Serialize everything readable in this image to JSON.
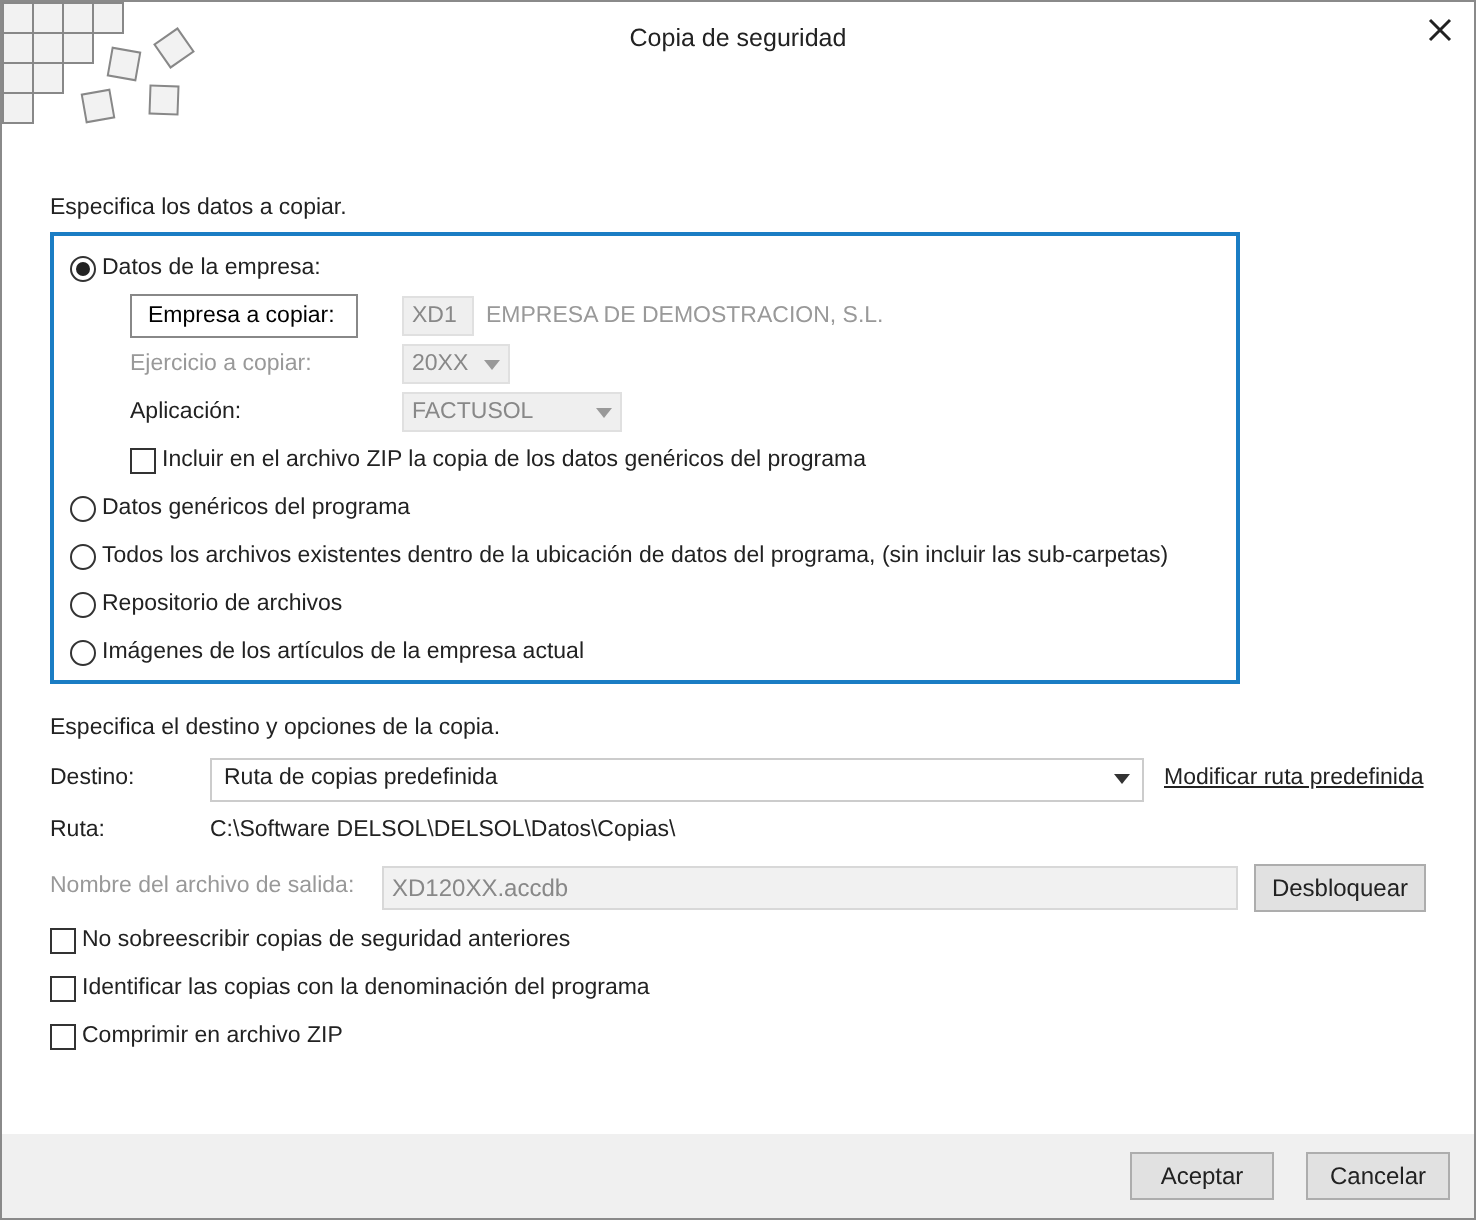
{
  "window": {
    "title": "Copia de seguridad"
  },
  "source": {
    "heading": "Especifica los datos a copiar.",
    "options": [
      {
        "label": "Datos de la empresa:",
        "selected": true
      },
      {
        "label": "Datos genéricos del programa",
        "selected": false
      },
      {
        "label": "Todos los archivos existentes dentro de la ubicación de datos del programa, (sin incluir las sub-carpetas)",
        "selected": false
      },
      {
        "label": "Repositorio de archivos",
        "selected": false
      },
      {
        "label": "Imágenes de los artículos de la empresa actual",
        "selected": false
      }
    ],
    "company": {
      "button": "Empresa a copiar:",
      "code": "XD1",
      "name": "EMPRESA DE DEMOSTRACION, S.L.",
      "year_label": "Ejercicio a copiar:",
      "year_disabled": true,
      "year": "20XX",
      "app_label": "Aplicación:",
      "app": "FACTUSOL",
      "include_zip": {
        "label": "Incluir en el archivo ZIP la copia de los datos genéricos del programa",
        "checked": false
      }
    }
  },
  "destination": {
    "heading": "Especifica el destino y opciones de la copia.",
    "destino_label": "Destino:",
    "destino": "Ruta de copias predefinida",
    "modify_link": "Modificar ruta predefinida",
    "ruta_label": "Ruta:",
    "ruta": "C:\\Software DELSOL\\DELSOL\\Datos\\Copias\\",
    "file_label": "Nombre del archivo de salida:",
    "file": "XD120XX.accdb",
    "unlock_button": "Desbloquear",
    "options": [
      {
        "label": "No sobreescribir copias de seguridad anteriores",
        "checked": false
      },
      {
        "label": "Identificar las copias con la denominación del programa",
        "checked": false
      },
      {
        "label": "Comprimir en archivo ZIP",
        "checked": false
      }
    ]
  },
  "buttons": [
    "Aceptar",
    "Cancelar"
  ]
}
